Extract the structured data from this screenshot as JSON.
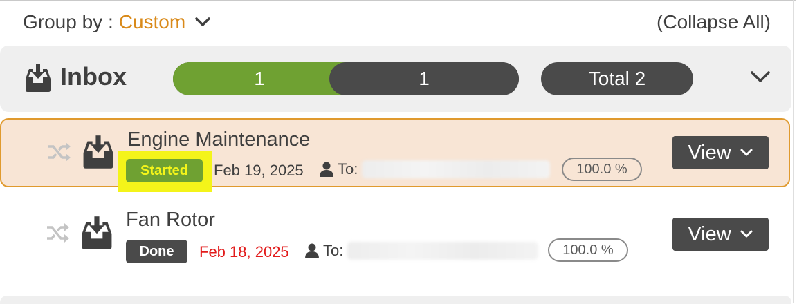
{
  "group_by": {
    "label": "Group by :",
    "value": "Custom",
    "collapse_all": "(Collapse All)"
  },
  "inbox": {
    "title": "Inbox",
    "progress_done": "1",
    "progress_rest": "1",
    "progress_fraction_done": 0.5,
    "total": "Total 2"
  },
  "rows": [
    {
      "title": "Engine Maintenance",
      "status": "Started",
      "date": "Feb 19, 2025",
      "to_label": "To:",
      "percent": "100.0 %",
      "view_label": "View"
    },
    {
      "title": "Fan Rotor",
      "status": "Done",
      "date": "Feb 18, 2025",
      "to_label": "To:",
      "percent": "100.0 %",
      "view_label": "View"
    }
  ],
  "colors": {
    "accent": "#d98a1a",
    "done_green": "#6fa132",
    "dark": "#4a4a4a",
    "overdue_red": "#e21b1b",
    "highlight": "#f4f41a"
  },
  "icons": [
    "chevron-down-icon",
    "inbox-download-icon",
    "shuffle-icon",
    "person-icon"
  ]
}
